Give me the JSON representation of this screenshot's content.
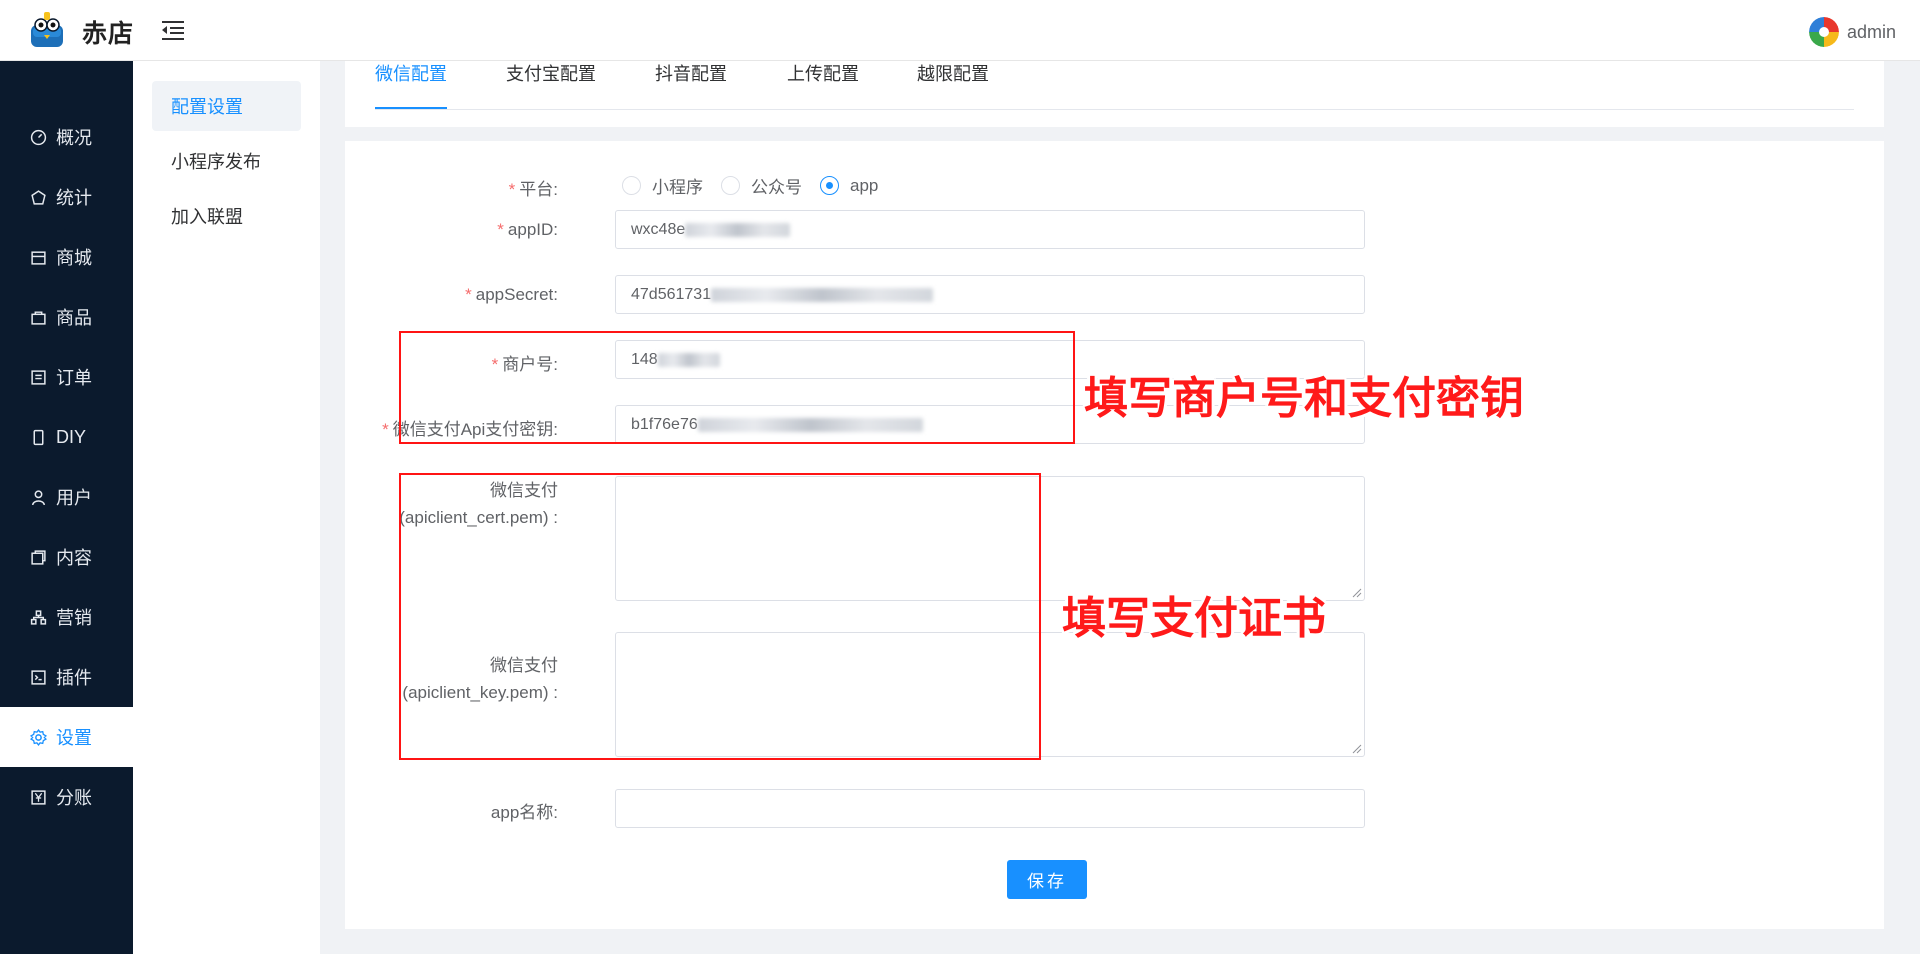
{
  "header": {
    "brand": "赤店",
    "user_name": "admin"
  },
  "sidebar": {
    "items": [
      {
        "label": "概况",
        "icon": "dashboard-icon"
      },
      {
        "label": "统计",
        "icon": "stats-icon"
      },
      {
        "label": "商城",
        "icon": "store-icon"
      },
      {
        "label": "商品",
        "icon": "bag-icon"
      },
      {
        "label": "订单",
        "icon": "order-icon"
      },
      {
        "label": "DIY",
        "icon": "phone-icon"
      },
      {
        "label": "用户",
        "icon": "user-icon"
      },
      {
        "label": "内容",
        "icon": "content-icon"
      },
      {
        "label": "营销",
        "icon": "marketing-icon"
      },
      {
        "label": "插件",
        "icon": "plugin-icon"
      },
      {
        "label": "设置",
        "icon": "gear-icon",
        "active": true
      },
      {
        "label": "分账",
        "icon": "split-icon"
      }
    ]
  },
  "submenu": {
    "items": [
      {
        "label": "配置设置",
        "active": true
      },
      {
        "label": "小程序发布"
      },
      {
        "label": "加入联盟"
      }
    ]
  },
  "tabs": [
    {
      "label": "微信配置",
      "active": true
    },
    {
      "label": "支付宝配置"
    },
    {
      "label": "抖音配置"
    },
    {
      "label": "上传配置"
    },
    {
      "label": "越限配置"
    }
  ],
  "form": {
    "platform_label": "平台:",
    "platform_options": [
      "小程序",
      "公众号",
      "app"
    ],
    "platform_selected": "app",
    "appid_label": "appID:",
    "appid_value": "wxc48e",
    "appsecret_label": "appSecret:",
    "appsecret_value": "47d561731",
    "mch_label": "商户号:",
    "mch_value": "148",
    "apikey_label": "微信支付Api支付密钥:",
    "apikey_value": "b1f76e76",
    "cert_label_1": "微信支付",
    "cert_label_2": "(apiclient_cert.pem) :",
    "key_label_1": "微信支付",
    "key_label_2": "(apiclient_key.pem) :",
    "appname_label": "app名称:",
    "appname_value": "",
    "save_label": "保存"
  },
  "annotations": {
    "merchant_note": "填写商户号和支付密钥",
    "cert_note": "填写支付证书"
  },
  "colors": {
    "accent": "#1890ff",
    "sidebar_bg": "#0b1a2d",
    "annotation_red": "#ff1414",
    "required": "#f56c6c"
  }
}
